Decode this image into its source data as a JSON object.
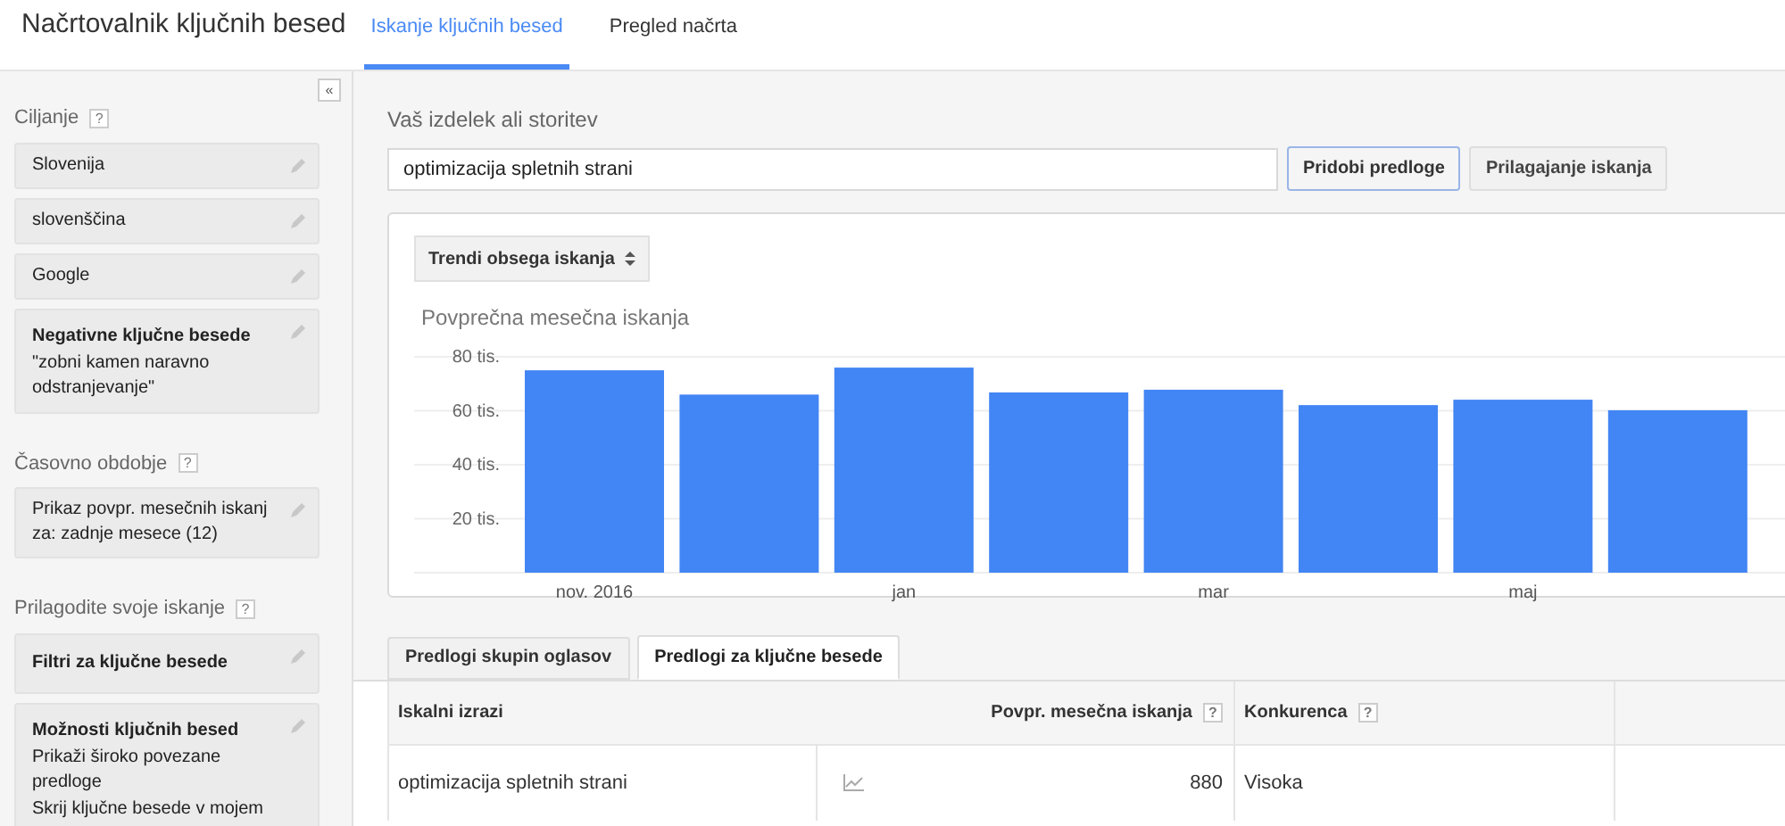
{
  "header": {
    "title": "Načrtovalnik ključnih besed"
  },
  "tabs": [
    {
      "label": "Iskanje ključnih besed",
      "selected": true
    },
    {
      "label": "Pregled načrta",
      "selected": false
    }
  ],
  "sidebar": {
    "collapse": "«",
    "sections": [
      {
        "heading": "Ciljanje",
        "help": "?",
        "cards": [
          {
            "lines": [
              "Slovenija"
            ]
          },
          {
            "lines": [
              "slovenščina"
            ]
          },
          {
            "lines": [
              "Google"
            ]
          },
          {
            "title": "Negativne ključne besede",
            "lines": [
              "\"zobni kamen naravno odstranjevanje\""
            ]
          }
        ]
      },
      {
        "heading": "Časovno obdobje",
        "help": "?",
        "cards": [
          {
            "lines": [
              "Prikaz povpr. mesečnih iskanj za: zadnje mesece (12)"
            ]
          }
        ]
      },
      {
        "heading": "Prilagodite svoje iskanje",
        "help": "?",
        "cards": [
          {
            "title": "Filtri za ključne besede"
          },
          {
            "title": "Možnosti ključnih besed",
            "lines": [
              "Prikaži široko povezane predloge",
              "Skrij ključne besede v mojem"
            ]
          }
        ]
      }
    ]
  },
  "search": {
    "label": "Vaš izdelek ali storitev",
    "value": "optimizacija spletnih strani",
    "buttons": [
      {
        "label": "Pridobi predloge",
        "kind": "primary"
      },
      {
        "label": "Prilagajanje iskanja",
        "kind": "secondary"
      }
    ]
  },
  "chart_panel": {
    "dropdown": "Trendi obsega iskanja",
    "chart_data": {
      "type": "bar",
      "title": "Povprečna mesečna iskanja",
      "categories": [
        "nov. 2016",
        null,
        "jan",
        null,
        "mar",
        null,
        "maj",
        null
      ],
      "series": [
        {
          "color": "#4285f4",
          "values": [
            75,
            66,
            76,
            66.8,
            67.8,
            62.1,
            64.1,
            60.2
          ]
        }
      ],
      "ylim": [
        0,
        80
      ],
      "grid": true,
      "yticks": [
        {
          "value": 20,
          "label": "20 tis."
        },
        {
          "value": 40,
          "label": "40 tis."
        },
        {
          "value": 60,
          "label": "60 tis."
        },
        {
          "value": 80,
          "label": "80 tis."
        }
      ]
    }
  },
  "result_tabs": [
    {
      "label": "Predlogi skupin oglasov",
      "selected": false
    },
    {
      "label": "Predlogi za ključne besede",
      "selected": true
    }
  ],
  "table": {
    "columns": [
      {
        "label": "Iskalni izrazi"
      },
      {
        "label": "Povpr. mesečna iskanja",
        "help": "?"
      },
      {
        "label": "Konkurenca",
        "help": "?"
      }
    ],
    "rows": [
      {
        "term": "optimizacija spletnih strani",
        "searches": "880",
        "competition": "Visoka"
      }
    ]
  }
}
